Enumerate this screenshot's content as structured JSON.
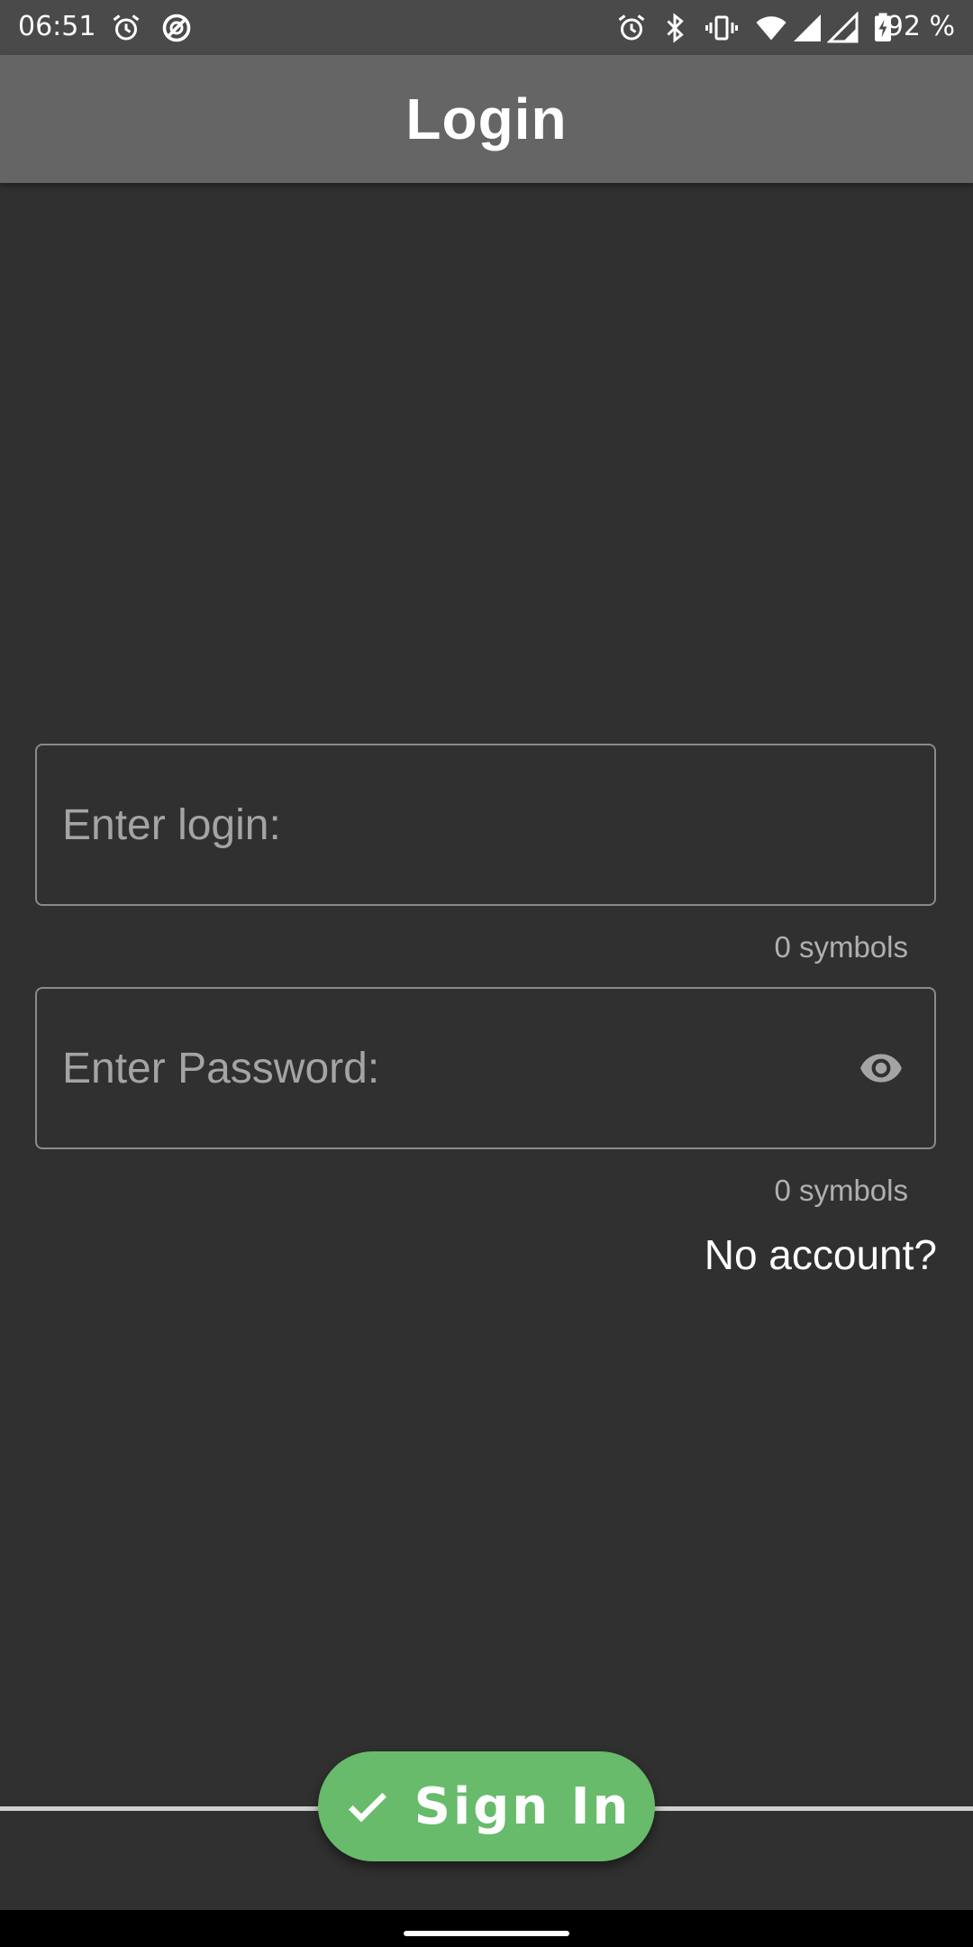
{
  "status_bar": {
    "time": "06:51",
    "battery_percent": "92 %",
    "left_icons": [
      "alarm-icon",
      "do-not-disturb-icon"
    ],
    "right_icons": [
      "alarm-icon",
      "bluetooth-icon",
      "vibrate-icon",
      "wifi-icon",
      "signal-icon",
      "signal-icon",
      "battery-charging-icon"
    ]
  },
  "app_bar": {
    "title": "Login"
  },
  "login_field": {
    "placeholder": "Enter login:",
    "value": "",
    "counter": "0 symbols"
  },
  "password_field": {
    "placeholder": "Enter Password:",
    "value": "",
    "counter": "0 symbols",
    "toggle_icon": "eye-icon"
  },
  "links": {
    "no_account": "No account?"
  },
  "sign_in_button": {
    "label": "Sign In",
    "icon": "check-icon",
    "color": "#67bb6a"
  },
  "colors": {
    "background": "#303030",
    "app_bar": "#656565",
    "status_bar": "#4a4a4a",
    "field_border": "#8a8a8a"
  }
}
